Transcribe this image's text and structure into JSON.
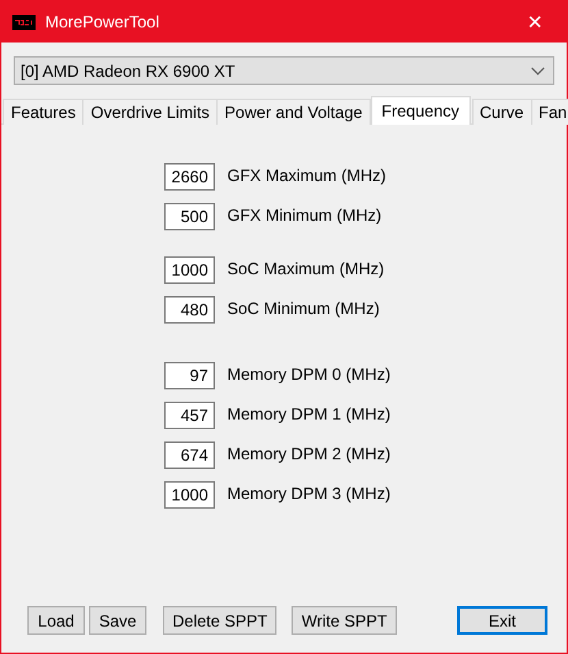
{
  "window": {
    "title": "MorePowerTool",
    "close": "✕"
  },
  "device_select": {
    "value": "[0] AMD Radeon RX 6900 XT"
  },
  "tabs": [
    {
      "label": "Features",
      "selected": false
    },
    {
      "label": "Overdrive Limits",
      "selected": false
    },
    {
      "label": "Power and Voltage",
      "selected": false
    },
    {
      "label": "Frequency",
      "selected": true
    },
    {
      "label": "Curve",
      "selected": false
    },
    {
      "label": "Fan",
      "selected": false
    }
  ],
  "groups": [
    {
      "fields": [
        {
          "value": "2660",
          "label": "GFX Maximum (MHz)"
        },
        {
          "value": "500",
          "label": "GFX Minimum (MHz)"
        }
      ]
    },
    {
      "fields": [
        {
          "value": "1000",
          "label": "SoC Maximum (MHz)"
        },
        {
          "value": "480",
          "label": "SoC Minimum (MHz)"
        }
      ]
    },
    {
      "fields": [
        {
          "value": "97",
          "label": "Memory DPM 0 (MHz)"
        },
        {
          "value": "457",
          "label": "Memory DPM 1 (MHz)"
        },
        {
          "value": "674",
          "label": "Memory DPM 2 (MHz)"
        },
        {
          "value": "1000",
          "label": "Memory DPM 3 (MHz)"
        }
      ]
    }
  ],
  "buttons": [
    {
      "label": "Load",
      "default": false
    },
    {
      "label": "Save",
      "default": false
    },
    {
      "label": "Delete SPPT",
      "default": false
    },
    {
      "label": "Write SPPT",
      "default": false
    },
    {
      "label": "Exit",
      "default": true
    }
  ]
}
